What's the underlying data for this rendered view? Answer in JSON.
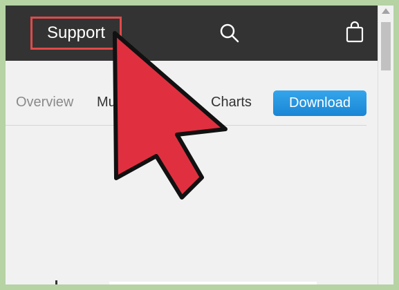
{
  "header": {
    "support_label": "Support",
    "search_icon": "search-icon",
    "bag_icon": "shopping-bag-icon"
  },
  "subnav": {
    "tabs": [
      {
        "label": "Overview"
      },
      {
        "label": "Mu"
      },
      {
        "label": "Charts"
      }
    ],
    "download_label": "Download"
  },
  "colors": {
    "topbar": "#333333",
    "highlight_box": "#e04a4a",
    "download_button": "#1f8fd9",
    "cursor_fill": "#e03040",
    "frame_border": "#b6d3a4"
  },
  "overlay": {
    "pointer": "arrow-cursor-icon"
  }
}
